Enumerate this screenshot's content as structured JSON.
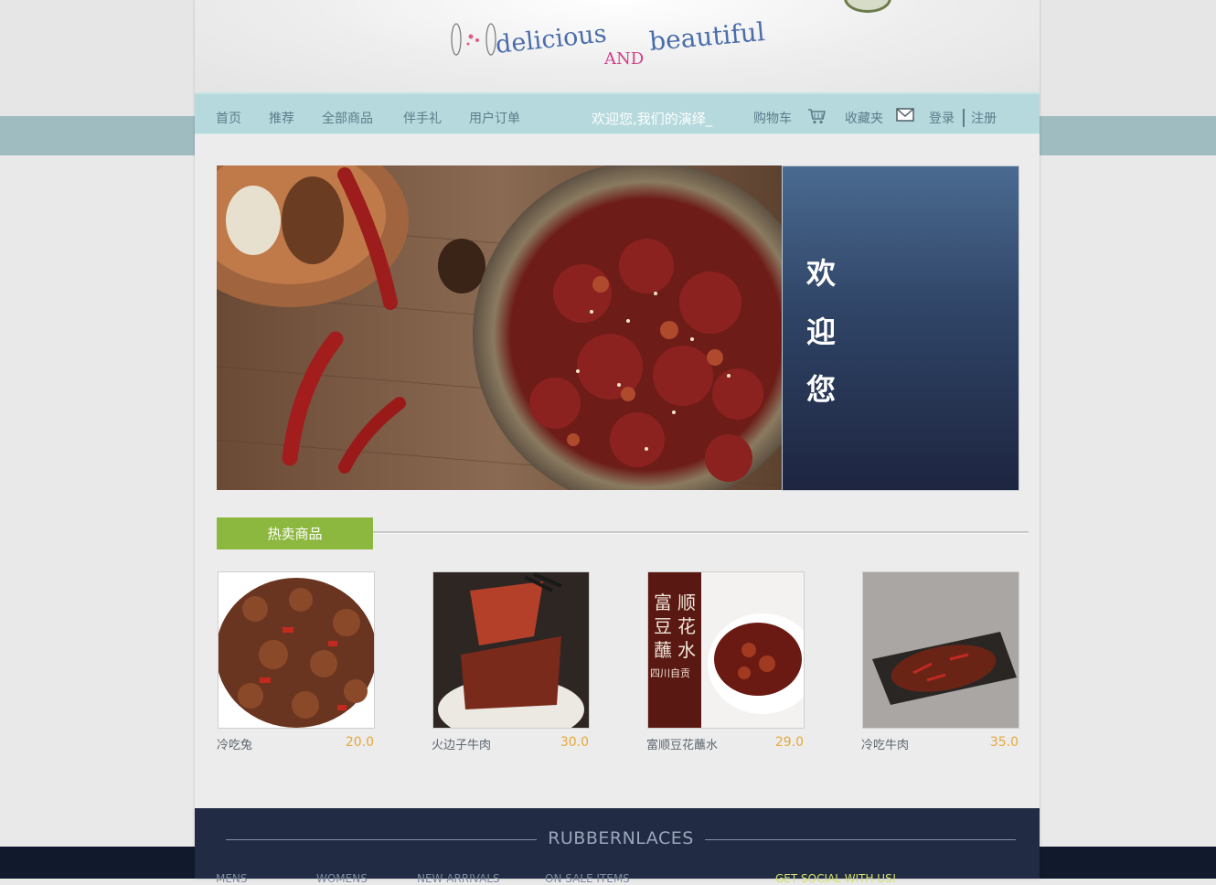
{
  "header": {
    "logo_text": "delicious AND beautiful"
  },
  "nav": {
    "items": [
      {
        "label": "首页"
      },
      {
        "label": "推荐"
      },
      {
        "label": "全部商品"
      },
      {
        "label": "伴手礼"
      },
      {
        "label": "用户订单"
      }
    ],
    "welcome": "欢迎您,我们的演绎_",
    "cart_label": "购物车",
    "favorites_label": "收藏夹",
    "login_label": "登录",
    "register_label": "注册"
  },
  "banner": {
    "chars": [
      "欢",
      "迎",
      "您"
    ]
  },
  "hot": {
    "section_title": "热卖商品",
    "products": [
      {
        "name": "冷吃兔",
        "price": "20.0"
      },
      {
        "name": "火边子牛肉",
        "price": "30.0"
      },
      {
        "name": "富顺豆花蘸水",
        "price": "29.0"
      },
      {
        "name": "冷吃牛肉",
        "price": "35.0"
      }
    ],
    "thumb3_text": [
      "富",
      "顺",
      "豆",
      "花",
      "蘸",
      "水",
      "四川自贡"
    ]
  },
  "footer": {
    "brand": "RUBBERNLACES",
    "links": [
      "MENS",
      "WOMENS",
      "NEW ARRIVALS",
      "ON SALE ITEMS"
    ],
    "social": "GET SOCIAL WITH US!"
  },
  "colors": {
    "nav_bg": "#b5d9dc",
    "accent_green": "#8db840",
    "price": "#e6a83a",
    "footer_bg": "#212c44"
  }
}
